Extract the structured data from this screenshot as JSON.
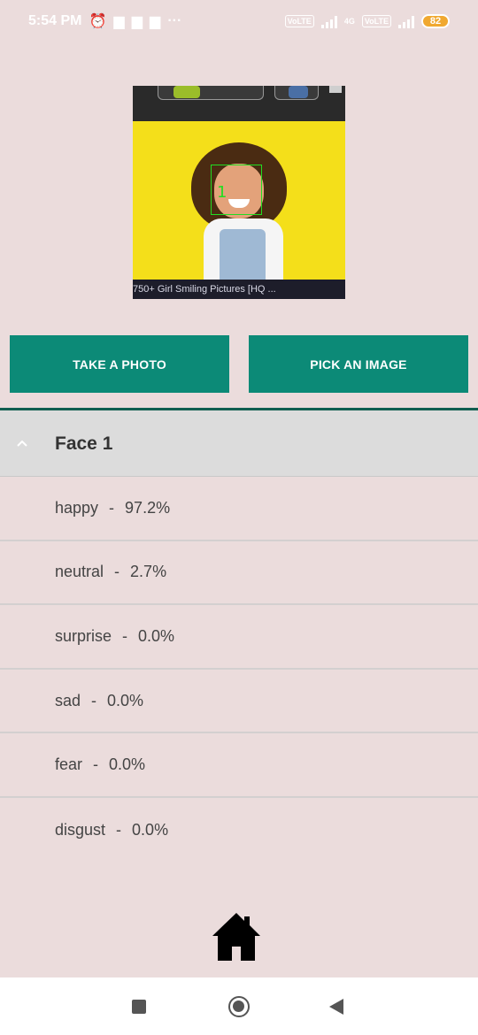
{
  "status_bar": {
    "time": "5:54 PM",
    "icons_left": [
      "alarm-icon",
      "message-icon",
      "message-icon",
      "message-icon",
      "more-dots-icon"
    ],
    "more": "···",
    "volte1": "VoLTE",
    "net": "4G",
    "volte2": "VoLTE",
    "battery": "82"
  },
  "image": {
    "caption": "750+ Girl Smiling Pictures [HQ ...",
    "detection_label": "1"
  },
  "buttons": {
    "take_photo": "TAKE A PHOTO",
    "pick_image": "PICK AN IMAGE"
  },
  "colors": {
    "background": "#ebdcdc",
    "button": "#0c8a77",
    "divider": "#115e50",
    "detection_box": "#22dd22"
  },
  "face_section": {
    "title": "Face 1",
    "emotions": [
      {
        "label": "happy",
        "sep": "-",
        "value": "97.2%"
      },
      {
        "label": "neutral",
        "sep": "-",
        "value": "2.7%"
      },
      {
        "label": "surprise",
        "sep": "-",
        "value": "0.0%"
      },
      {
        "label": "sad",
        "sep": "-",
        "value": "0.0%"
      },
      {
        "label": "fear",
        "sep": "-",
        "value": "0.0%"
      },
      {
        "label": "disgust",
        "sep": "-",
        "value": "0.0%"
      }
    ]
  },
  "icons": {
    "home": "home-icon",
    "nav_recent": "square-icon",
    "nav_home": "circle-icon",
    "nav_back": "triangle-back-icon"
  }
}
